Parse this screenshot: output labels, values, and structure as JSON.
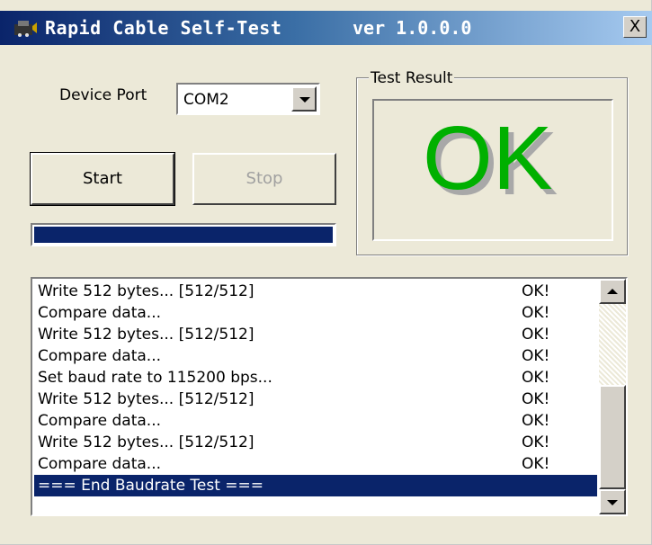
{
  "window": {
    "title": "Rapid Cable Self-Test",
    "version": "ver 1.0.0.0",
    "close_label": "X"
  },
  "device": {
    "label": "Device Port",
    "selected": "COM2"
  },
  "buttons": {
    "start": "Start",
    "stop": "Stop"
  },
  "progress": {
    "value": 1.0
  },
  "result": {
    "group_label": "Test Result",
    "text": "OK",
    "color": "#00b000"
  },
  "log": {
    "rows": [
      {
        "message": "Write 512 bytes... [512/512]",
        "status": "OK!"
      },
      {
        "message": "Compare data...",
        "status": "OK!"
      },
      {
        "message": "Write 512 bytes... [512/512]",
        "status": "OK!"
      },
      {
        "message": "Compare data...",
        "status": "OK!"
      },
      {
        "message": "Set baud rate to 115200 bps...",
        "status": "OK!"
      },
      {
        "message": "Write 512 bytes... [512/512]",
        "status": "OK!"
      },
      {
        "message": "Compare data...",
        "status": "OK!"
      },
      {
        "message": "Write 512 bytes... [512/512]",
        "status": "OK!"
      },
      {
        "message": "Compare data...",
        "status": "OK!"
      },
      {
        "message": "=== End Baudrate Test ===",
        "status": ""
      }
    ],
    "selected_index": 9
  },
  "icons": {
    "app": "app-icon",
    "close": "close-icon",
    "dropdown": "chevron-down-icon",
    "scroll_up": "scroll-up-icon",
    "scroll_down": "scroll-down-icon"
  }
}
